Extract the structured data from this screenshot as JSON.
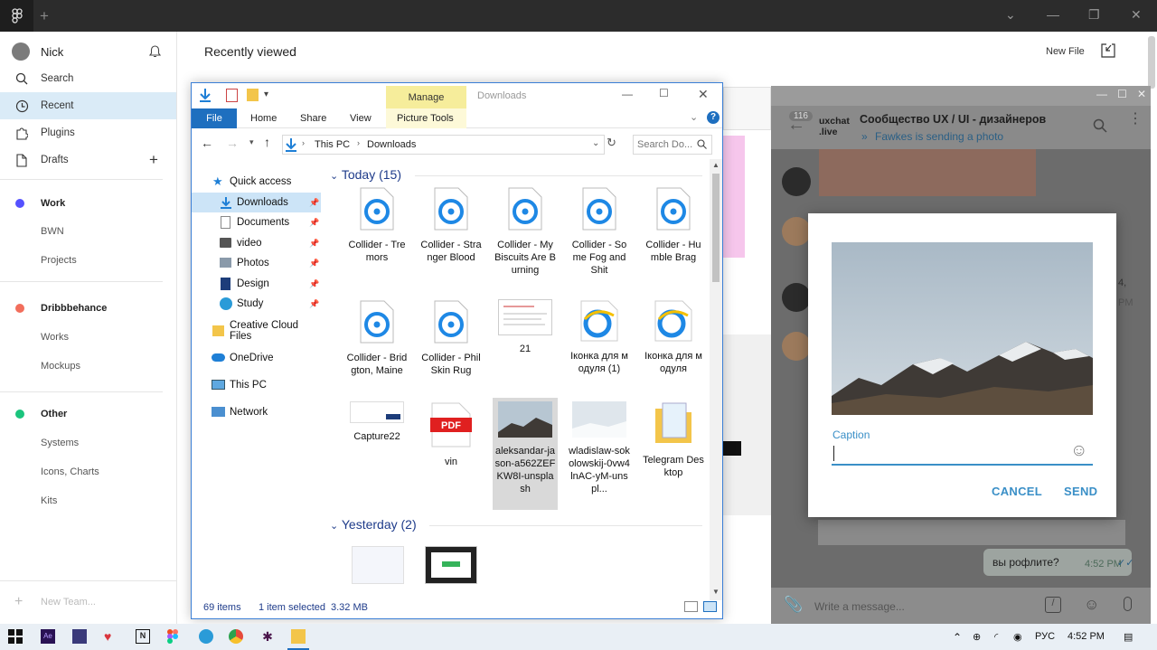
{
  "figma": {
    "user_name": "Nick",
    "nav": [
      {
        "label": "Search"
      },
      {
        "label": "Recent"
      },
      {
        "label": "Plugins"
      },
      {
        "label": "Drafts"
      }
    ],
    "teams": [
      {
        "name": "Work",
        "color": "#5551ff",
        "projects": [
          "BWN",
          "Projects"
        ]
      },
      {
        "name": "Dribbbehance",
        "color": "#f24e1e",
        "projects": [
          "Works",
          "Mockups"
        ]
      },
      {
        "name": "Other",
        "color": "#1bc47d",
        "projects": [
          "Systems",
          "Icons, Charts",
          "Kits"
        ]
      }
    ],
    "new_team": "New Team...",
    "page_title": "Recently viewed",
    "new_file": "New File"
  },
  "explorer": {
    "title": "Downloads",
    "manage_tab": "Manage",
    "ribbon_tabs": [
      "File",
      "Home",
      "Share",
      "View",
      "Picture Tools"
    ],
    "breadcrumb": [
      "This PC",
      "Downloads"
    ],
    "search_placeholder": "Search Do...",
    "nav": [
      {
        "label": "Quick access"
      },
      {
        "label": "Downloads"
      },
      {
        "label": "Documents"
      },
      {
        "label": "video"
      },
      {
        "label": "Photos"
      },
      {
        "label": "Design"
      },
      {
        "label": "Study"
      },
      {
        "label": "Creative Cloud Files"
      },
      {
        "label": "OneDrive"
      },
      {
        "label": "This PC"
      },
      {
        "label": "Network"
      }
    ],
    "group_today": "Today (15)",
    "group_yesterday": "Yesterday (2)",
    "files_today": [
      {
        "name": "Collider - Tremors",
        "type": "collider"
      },
      {
        "name": "Collider - Stranger Blood",
        "type": "collider"
      },
      {
        "name": "Collider - My Biscuits Are Burning",
        "type": "collider"
      },
      {
        "name": "Collider - Some Fog and Shit",
        "type": "collider"
      },
      {
        "name": "Collider - Humble Brag",
        "type": "collider"
      },
      {
        "name": "Collider - Bridgton, Maine",
        "type": "collider"
      },
      {
        "name": "Collider - Phil Skin Rug",
        "type": "collider"
      },
      {
        "name": "21",
        "type": "doc"
      },
      {
        "name": "Іконка для модуля (1)",
        "type": "ie"
      },
      {
        "name": "Іконка для модуля",
        "type": "ie"
      },
      {
        "name": "Capture22",
        "type": "capture"
      },
      {
        "name": "vin",
        "type": "pdf"
      },
      {
        "name": "aleksandar-jason-a562ZEFKW8I-unsplash",
        "type": "mountain"
      },
      {
        "name": "wladislaw-sokolowskij-0vw4lnAC-yM-unspl...",
        "type": "snow"
      },
      {
        "name": "Telegram Desktop",
        "type": "folder"
      }
    ],
    "status_items": "69 items",
    "status_selected": "1 item selected",
    "status_size": "3.32 MB"
  },
  "telegram": {
    "unread": "116",
    "logo_text": "uxchat\n.live",
    "chat_title": "Сообщество UX / UI - дизайнеров",
    "chat_status": "Fawkes is sending a photo",
    "side_fragments": [
      "4,",
      "PM"
    ],
    "last_message": "вы рофлите?",
    "last_time": "4:52 PM",
    "input_placeholder": "Write a message...",
    "dialog": {
      "caption_label": "Caption",
      "cancel": "CANCEL",
      "send": "SEND"
    }
  },
  "taskbar": {
    "lang": "РУС",
    "time": "4:52 PM"
  }
}
